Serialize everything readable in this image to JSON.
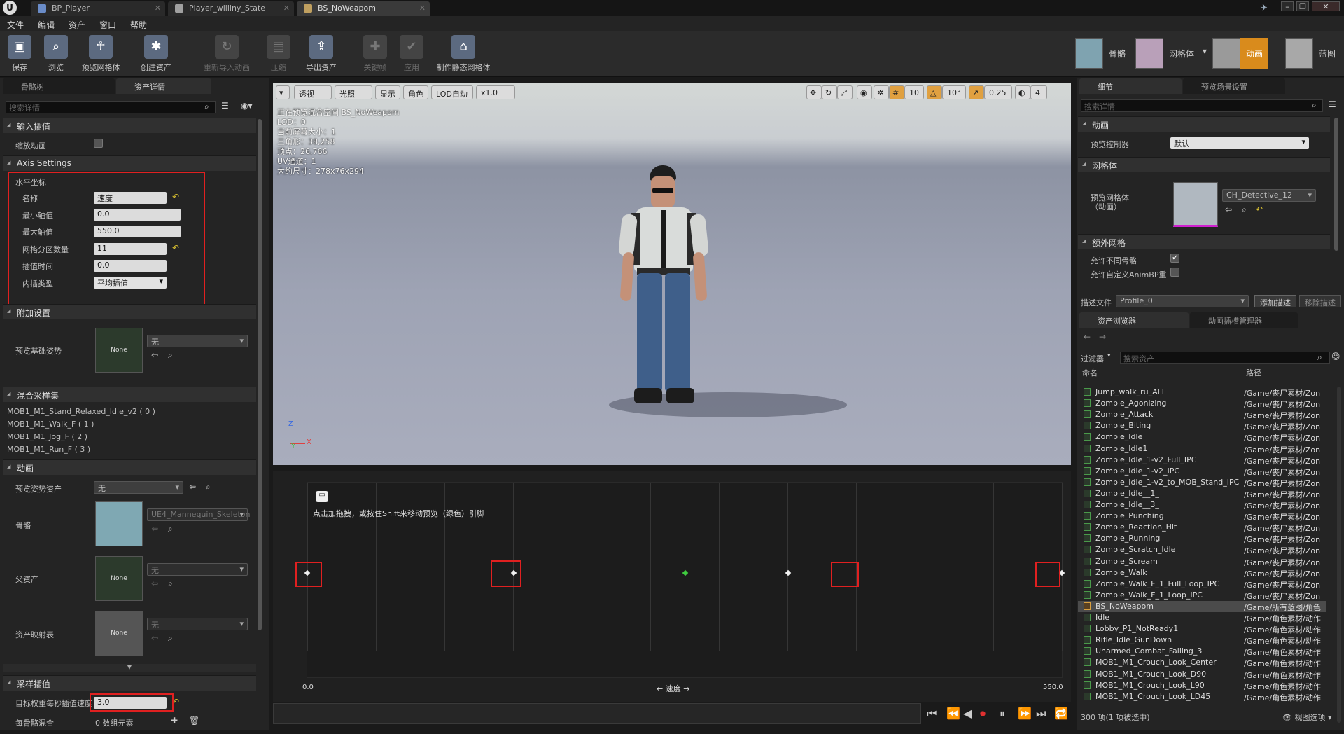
{
  "tabs": [
    {
      "label": "BP_Player"
    },
    {
      "label": "Player_williny_State"
    },
    {
      "label": "BS_NoWeapom"
    }
  ],
  "menu": [
    "文件",
    "编辑",
    "资产",
    "窗口",
    "帮助"
  ],
  "toolbar": {
    "save": "保存",
    "browse": "浏览",
    "preview_mesh": "预览网格体",
    "create_asset": "创建资产",
    "reimport": "重新导入动画",
    "compress": "压缩",
    "export": "导出资产",
    "keyframe": "关键帧",
    "apply": "应用",
    "make_static": "制作静态网格体"
  },
  "modes": {
    "skeleton": "骨骼",
    "mesh": "网格体",
    "animation": "动画",
    "blueprint": "蓝图"
  },
  "left": {
    "tabs": {
      "skeleton_tree": "骨骼树",
      "asset_details": "资产详情"
    },
    "search_placeholder": "搜索详情",
    "input_interp": {
      "header": "输入插值",
      "scale_anim": "缩放动画"
    },
    "axis": {
      "header": "Axis Settings",
      "horizontal": "水平坐标",
      "name_label": "名称",
      "name_value": "速度",
      "min_label": "最小轴值",
      "min_value": "0.0",
      "max_label": "最大轴值",
      "max_value": "550.0",
      "grid_label": "网格分区数量",
      "grid_value": "11",
      "interp_time_label": "插值时间",
      "interp_time_value": "0.0",
      "interp_type_label": "内插类型",
      "interp_type_value": "平均插值"
    },
    "additive": {
      "header": "附加设置",
      "base_pose": "预览基础姿势",
      "none": "None",
      "value": "无"
    },
    "samples": {
      "header": "混合采样集",
      "items": [
        "MOB1_M1_Stand_Relaxed_Idle_v2 ( 0 )",
        "MOB1_M1_Walk_F ( 1 )",
        "MOB1_M1_Jog_F ( 2 )",
        "MOB1_M1_Run_F ( 3 )"
      ]
    },
    "anim": {
      "header": "动画",
      "preview_pose": "预览姿势资产",
      "preview_pose_value": "无",
      "skeleton": "骨骼",
      "skeleton_value": "UE4_Mannequin_Skeleton",
      "parent": "父资产",
      "parent_value": "无",
      "none": "None",
      "mapping": "资产映射表",
      "mapping_value": "无"
    },
    "sample_interp": {
      "header": "采样插值",
      "target_speed": "目标权重每秒插值速度",
      "target_value": "3.0",
      "per_bone": "每骨骼混合",
      "per_bone_value": "0 数组元素"
    }
  },
  "viewport": {
    "perspective": "透视",
    "lit": "光照",
    "show": "显示",
    "character": "角色",
    "lod": "LOD自动",
    "speed": "x1.0",
    "grid_snap": "10",
    "rot_snap": "10°",
    "scale_snap": "0.25",
    "cam_speed": "4",
    "info": [
      "正在预览混合空间 BS_NoWeapom",
      "LOD：0",
      "当前屏幕大小：1",
      "三角形：38,258",
      "顶点：26,766",
      "UV通道：1",
      "大约尺寸：278x76x294"
    ]
  },
  "blendspace": {
    "hint": "点击加拖拽，或按住Shift来移动预览（绿色）引脚",
    "axis_min": "0.0",
    "axis_max": "550.0",
    "axis_name": "速度"
  },
  "right": {
    "tabs": {
      "details": "细节",
      "preview_settings": "预览场景设置"
    },
    "search_placeholder": "搜索详情",
    "anim_header": "动画",
    "preview_controller": "预览控制器",
    "preview_controller_value": "默认",
    "mesh_header": "网格体",
    "preview_mesh": "预览网格体\n（动画）",
    "preview_mesh_value": "CH_Detective_12",
    "extra_header": "额外网格",
    "allow_diff": "允许不同骨骼",
    "allow_custom": "允许自定义AnimBP重",
    "profile_label": "描述文件",
    "profile_value": "Profile_0",
    "add_profile": "添加描述",
    "remove_profile": "移除描述",
    "browser_tabs": {
      "asset_browser": "资产浏览器",
      "montage": "动画插槽管理器"
    },
    "filter": "过滤器",
    "search_assets": "搜索资产",
    "col_name": "命名",
    "col_path": "路径",
    "assets": [
      {
        "name": "Jump_walk_ru_ALL",
        "path": "/Game/丧尸素材/Zon"
      },
      {
        "name": "Zombie_Agonizing",
        "path": "/Game/丧尸素材/Zon"
      },
      {
        "name": "Zombie_Attack",
        "path": "/Game/丧尸素材/Zon"
      },
      {
        "name": "Zombie_Biting",
        "path": "/Game/丧尸素材/Zon"
      },
      {
        "name": "Zombie_Idle",
        "path": "/Game/丧尸素材/Zon"
      },
      {
        "name": "Zombie_Idle1",
        "path": "/Game/丧尸素材/Zon"
      },
      {
        "name": "Zombie_Idle_1-v2_Full_IPC",
        "path": "/Game/丧尸素材/Zon"
      },
      {
        "name": "Zombie_Idle_1-v2_IPC",
        "path": "/Game/丧尸素材/Zon"
      },
      {
        "name": "Zombie_Idle_1-v2_to_MOB_Stand_IPC",
        "path": "/Game/丧尸素材/Zon"
      },
      {
        "name": "Zombie_Idle__1_",
        "path": "/Game/丧尸素材/Zon"
      },
      {
        "name": "Zombie_Idle__3_",
        "path": "/Game/丧尸素材/Zon"
      },
      {
        "name": "Zombie_Punching",
        "path": "/Game/丧尸素材/Zon"
      },
      {
        "name": "Zombie_Reaction_Hit",
        "path": "/Game/丧尸素材/Zon"
      },
      {
        "name": "Zombie_Running",
        "path": "/Game/丧尸素材/Zon"
      },
      {
        "name": "Zombie_Scratch_Idle",
        "path": "/Game/丧尸素材/Zon"
      },
      {
        "name": "Zombie_Scream",
        "path": "/Game/丧尸素材/Zon"
      },
      {
        "name": "Zombie_Walk",
        "path": "/Game/丧尸素材/Zon"
      },
      {
        "name": "Zombie_Walk_F_1_Full_Loop_IPC",
        "path": "/Game/丧尸素材/Zon"
      },
      {
        "name": "Zombie_Walk_F_1_Loop_IPC",
        "path": "/Game/丧尸素材/Zon"
      },
      {
        "name": "BS_NoWeapom",
        "path": "/Game/所有蓝图/角色"
      },
      {
        "name": "Idle",
        "path": "/Game/角色素材/动作"
      },
      {
        "name": "Lobby_P1_NotReady1",
        "path": "/Game/角色素材/动作"
      },
      {
        "name": "Rifle_Idle_GunDown",
        "path": "/Game/角色素材/动作"
      },
      {
        "name": "Unarmed_Combat_Falling_3",
        "path": "/Game/角色素材/动作"
      },
      {
        "name": "MOB1_M1_Crouch_Look_Center",
        "path": "/Game/角色素材/动作"
      },
      {
        "name": "MOB1_M1_Crouch_Look_D90",
        "path": "/Game/角色素材/动作"
      },
      {
        "name": "MOB1_M1_Crouch_Look_L90",
        "path": "/Game/角色素材/动作"
      },
      {
        "name": "MOB1_M1_Crouch_Look_LD45",
        "path": "/Game/角色素材/动作"
      }
    ],
    "status": "300 项(1 项被选中)",
    "view_options": "视图选项"
  }
}
